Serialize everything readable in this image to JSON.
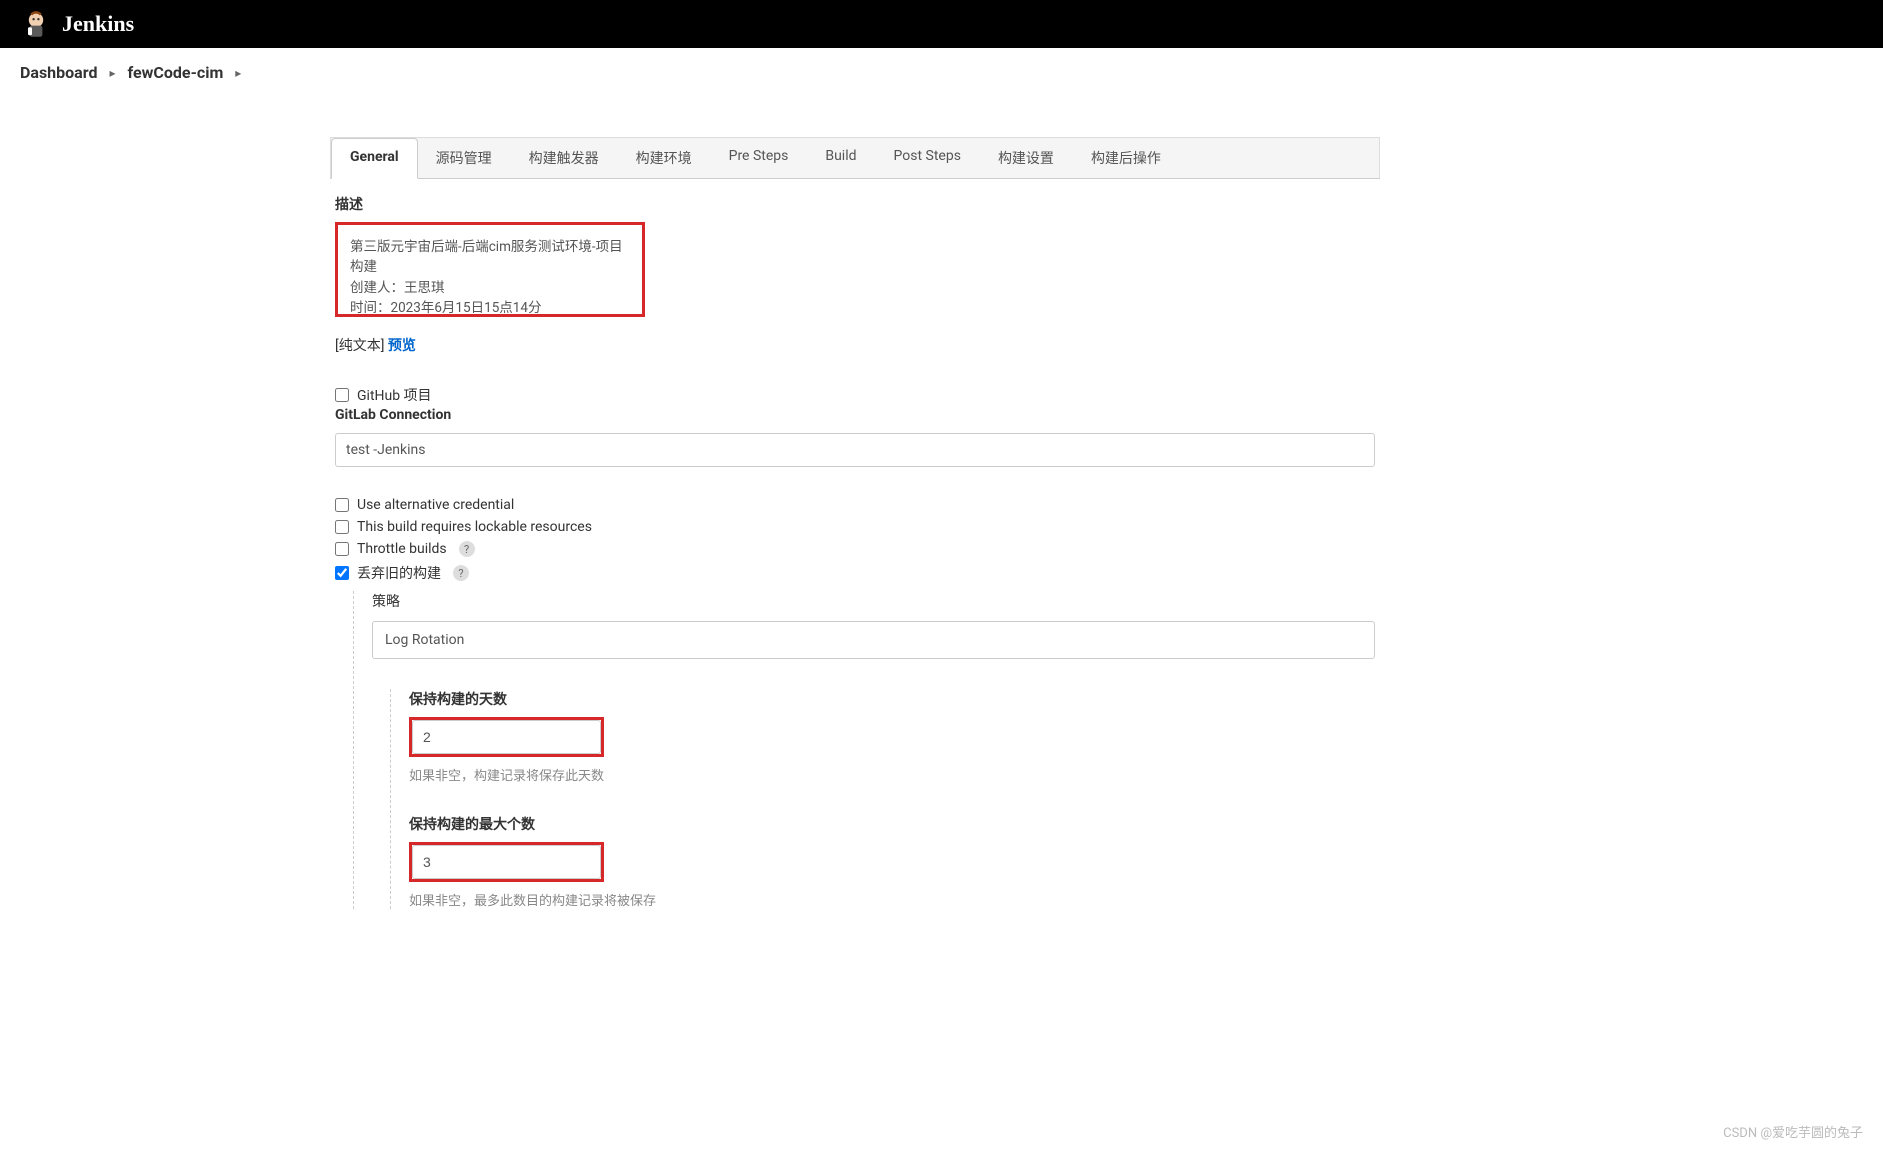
{
  "header": {
    "product": "Jenkins"
  },
  "breadcrumbs": {
    "items": [
      "Dashboard",
      "fewCode-cim"
    ]
  },
  "tabs": {
    "items": [
      "General",
      "源码管理",
      "构建触发器",
      "构建环境",
      "Pre Steps",
      "Build",
      "Post Steps",
      "构建设置",
      "构建后操作"
    ],
    "active": 0
  },
  "form": {
    "description_label": "描述",
    "description_line1": "第三版元宇宙后端-后端cim服务测试环境-项目构建",
    "description_line2": "创建人：王思琪",
    "description_line3": "时间：2023年6月15日15点14分",
    "plaintext_bracket": "[纯文本]",
    "preview_link": "预览",
    "github_project": "GitHub 项目",
    "gitlab_connection": "GitLab Connection",
    "gitlab_value": "test -Jenkins",
    "alt_credential": "Use alternative credential",
    "lockable": "This build requires lockable resources",
    "throttle": "Throttle builds",
    "discard_old": "丢弃旧的构建",
    "strategy_label": "策略",
    "strategy_value": "Log Rotation",
    "days_keep_label": "保持构建的天数",
    "days_keep_value": "2",
    "days_keep_hint": "如果非空，构建记录将保存此天数",
    "max_keep_label": "保持构建的最大个数",
    "max_keep_value": "3",
    "max_keep_hint": "如果非空，最多此数目的构建记录将被保存",
    "help_icon": "?"
  },
  "watermark": "CSDN @爱吃芋圆的兔子"
}
